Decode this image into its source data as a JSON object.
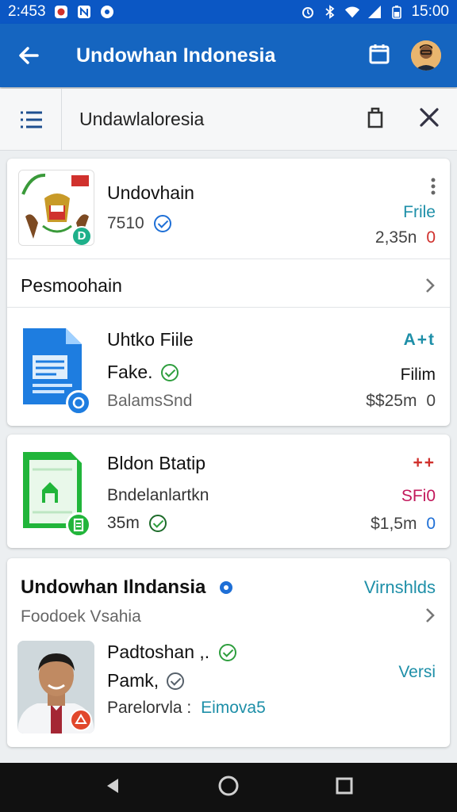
{
  "status": {
    "time_left": "2:453",
    "time_right": "15:00"
  },
  "appbar": {
    "title": "Undowhan Indonesia"
  },
  "toolbar": {
    "label": "Undawlaloresia"
  },
  "card1": {
    "name": "Undovhain",
    "count": "7510",
    "badge": "D",
    "right_link": "Frile",
    "right_value": "2,35n",
    "right_value_suffix": "0"
  },
  "section": {
    "label": "Pesmoohain"
  },
  "file1": {
    "title": "Uhtko Fiile",
    "status": "Fake.",
    "meta": "BalamsSnd",
    "right_icon_text": "A+t",
    "right_label": "Filim",
    "right_value": "$$25m",
    "right_value_suffix": "0"
  },
  "file2": {
    "title": "Bldon Btatip",
    "sub": "Bndelanlartkn",
    "count": "35m",
    "right_icon_text": "++",
    "right_label": "SFi0",
    "right_value": "$1,5m",
    "right_value_suffix": "0"
  },
  "profile": {
    "header": "Undowhan Ilndansia",
    "header_link": "Virnshlds",
    "subheader": "Foodoek Vsahia",
    "name": "Padtoshan ,.",
    "role": "Pamk,",
    "meta_label": "Parelorvla :",
    "meta_value": "Eimova5",
    "right_link": "Versi"
  },
  "colors": {
    "appbar": "#1565c0",
    "statusbar": "#0b57c4",
    "accent_blue": "#1e6fd6",
    "accent_teal": "#1e8fa8",
    "accent_red": "#d0312d",
    "accent_pink": "#c2185b",
    "accent_green": "#2e9e3e"
  }
}
